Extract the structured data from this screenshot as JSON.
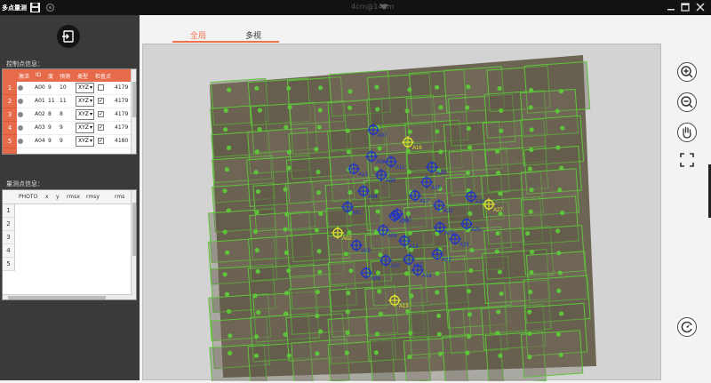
{
  "window": {
    "title": "多点量测",
    "center_label": "4cm@146m",
    "controls": [
      "minimize",
      "maximize",
      "close"
    ]
  },
  "toolbar_icons": [
    "save-icon",
    "settings-icon"
  ],
  "left_panel": {
    "control_section_label": "控制点信息：",
    "control_table": {
      "headers": [
        "激活",
        "ID",
        "度",
        "预测",
        "类型",
        "检查点"
      ],
      "rows": [
        {
          "num": "1",
          "id": "A00",
          "a": "9",
          "b": "10",
          "type": "XYZ",
          "check": "",
          "val": "4179"
        },
        {
          "num": "2",
          "id": "A01",
          "a": "11",
          "b": "11",
          "type": "XYZ",
          "check": "✓",
          "val": "4179"
        },
        {
          "num": "3",
          "id": "A02",
          "a": "8",
          "b": "8",
          "type": "XYZ",
          "check": "✓",
          "val": "4179"
        },
        {
          "num": "4",
          "id": "A03",
          "a": "9",
          "b": "9",
          "type": "XYZ",
          "check": "✓",
          "val": "4179"
        },
        {
          "num": "5",
          "id": "A04",
          "a": "9",
          "b": "9",
          "type": "XYZ",
          "check": "✓",
          "val": "4180"
        }
      ]
    },
    "tie_section_label": "量测点信息：",
    "tie_table": {
      "headers": [
        "PHOTO",
        "x",
        "y",
        "rmsx",
        "rmsy",
        "rms"
      ],
      "rows": [
        "1",
        "2",
        "3",
        "4",
        "5"
      ]
    }
  },
  "tabs": [
    {
      "label": "全局",
      "active": true
    },
    {
      "label": "多视",
      "active": false
    }
  ],
  "map": {
    "active_color": "#1a2fd0",
    "highlight_color": "#e8ea2a",
    "footprint_color": "#5ec43a",
    "points": [
      {
        "label": "A07",
        "kind": "blue"
      },
      {
        "label": "A16",
        "kind": "yellow"
      },
      {
        "label": "A06",
        "kind": "blue"
      },
      {
        "label": "A11",
        "kind": "blue"
      },
      {
        "label": "A12",
        "kind": "blue"
      },
      {
        "label": "A09",
        "kind": "blue"
      },
      {
        "label": "A20",
        "kind": "blue"
      },
      {
        "label": "A19",
        "kind": "blue"
      },
      {
        "label": "A04",
        "kind": "blue"
      },
      {
        "label": "A17",
        "kind": "blue"
      },
      {
        "label": "A26",
        "kind": "blue"
      },
      {
        "label": "A27",
        "kind": "yellow"
      },
      {
        "label": "A01",
        "kind": "blue"
      },
      {
        "label": "A28",
        "kind": "blue"
      },
      {
        "label": "A21",
        "kind": "blue"
      },
      {
        "label": "A00",
        "kind": "blue"
      },
      {
        "label": "A08",
        "kind": "blue"
      },
      {
        "label": "A23",
        "kind": "blue"
      },
      {
        "label": "A25",
        "kind": "blue"
      },
      {
        "label": "A02",
        "kind": "yellow"
      },
      {
        "label": "A14",
        "kind": "blue"
      },
      {
        "label": "A24",
        "kind": "blue"
      },
      {
        "label": "A03",
        "kind": "blue"
      },
      {
        "label": "A10",
        "kind": "blue"
      },
      {
        "label": "A15",
        "kind": "blue"
      },
      {
        "label": "A22",
        "kind": "blue"
      },
      {
        "label": "A18",
        "kind": "blue"
      },
      {
        "label": "A05",
        "kind": "blue"
      },
      {
        "label": "A13",
        "kind": "yellow"
      }
    ]
  },
  "right_toolbar": [
    "zoom-in-icon",
    "zoom-out-icon",
    "pan-hand-icon",
    "fit-extent-icon",
    "reset-view-icon"
  ]
}
